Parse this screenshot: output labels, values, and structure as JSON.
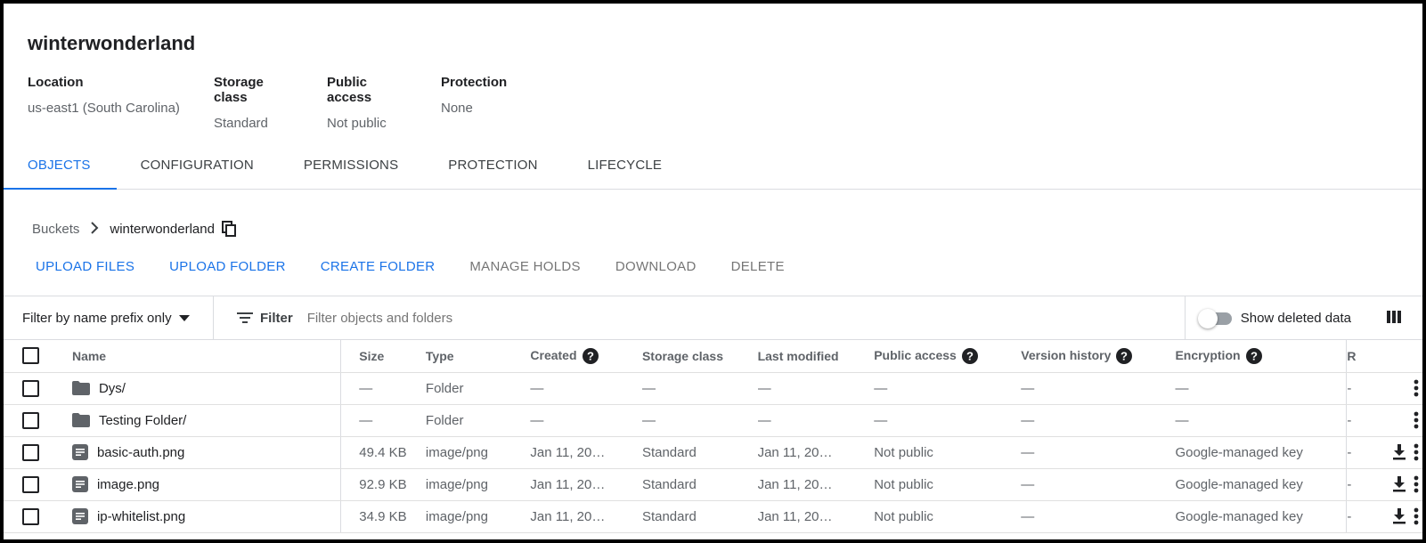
{
  "bucket": {
    "title": "winterwonderland",
    "properties": [
      {
        "label": "Location",
        "value": "us-east1 (South Carolina)"
      },
      {
        "label": "Storage class",
        "value": "Standard"
      },
      {
        "label": "Public access",
        "value": "Not public"
      },
      {
        "label": "Protection",
        "value": "None"
      }
    ]
  },
  "tabs": [
    "OBJECTS",
    "CONFIGURATION",
    "PERMISSIONS",
    "PROTECTION",
    "LIFECYCLE"
  ],
  "active_tab": "OBJECTS",
  "breadcrumb": {
    "root": "Buckets",
    "current": "winterwonderland"
  },
  "actions": {
    "upload_files": "UPLOAD FILES",
    "upload_folder": "UPLOAD FOLDER",
    "create_folder": "CREATE FOLDER",
    "manage_holds": "MANAGE HOLDS",
    "download": "DOWNLOAD",
    "delete": "DELETE"
  },
  "filter": {
    "prefix_label": "Filter by name prefix only",
    "filter_label": "Filter",
    "placeholder": "Filter objects and folders",
    "show_deleted_label": "Show deleted data"
  },
  "table": {
    "headers": {
      "name": "Name",
      "size": "Size",
      "type": "Type",
      "created": "Created",
      "storage_class": "Storage class",
      "last_modified": "Last modified",
      "public_access": "Public access",
      "version_history": "Version history",
      "encryption": "Encryption",
      "extra": "R"
    },
    "rows": [
      {
        "name": "Dys/",
        "kind": "folder",
        "size": "—",
        "type": "Folder",
        "created": "—",
        "storage_class": "—",
        "last_modified": "—",
        "public_access": "—",
        "version_history": "—",
        "encryption": "—",
        "extra": "-"
      },
      {
        "name": "Testing Folder/",
        "kind": "folder",
        "size": "—",
        "type": "Folder",
        "created": "—",
        "storage_class": "—",
        "last_modified": "—",
        "public_access": "—",
        "version_history": "—",
        "encryption": "—",
        "extra": "-"
      },
      {
        "name": "basic-auth.png",
        "kind": "file",
        "size": "49.4 KB",
        "type": "image/png",
        "created": "Jan 11, 20…",
        "storage_class": "Standard",
        "last_modified": "Jan 11, 20…",
        "public_access": "Not public",
        "version_history": "—",
        "encryption": "Google-managed key",
        "extra": "-"
      },
      {
        "name": "image.png",
        "kind": "file",
        "size": "92.9 KB",
        "type": "image/png",
        "created": "Jan 11, 20…",
        "storage_class": "Standard",
        "last_modified": "Jan 11, 20…",
        "public_access": "Not public",
        "version_history": "—",
        "encryption": "Google-managed key",
        "extra": "-"
      },
      {
        "name": "ip-whitelist.png",
        "kind": "file",
        "size": "34.9 KB",
        "type": "image/png",
        "created": "Jan 11, 20…",
        "storage_class": "Standard",
        "last_modified": "Jan 11, 20…",
        "public_access": "Not public",
        "version_history": "—",
        "encryption": "Google-managed key",
        "extra": "-"
      }
    ]
  },
  "colors": {
    "accent": "#1a73e8",
    "text": "#202124",
    "muted": "#5f6368"
  }
}
